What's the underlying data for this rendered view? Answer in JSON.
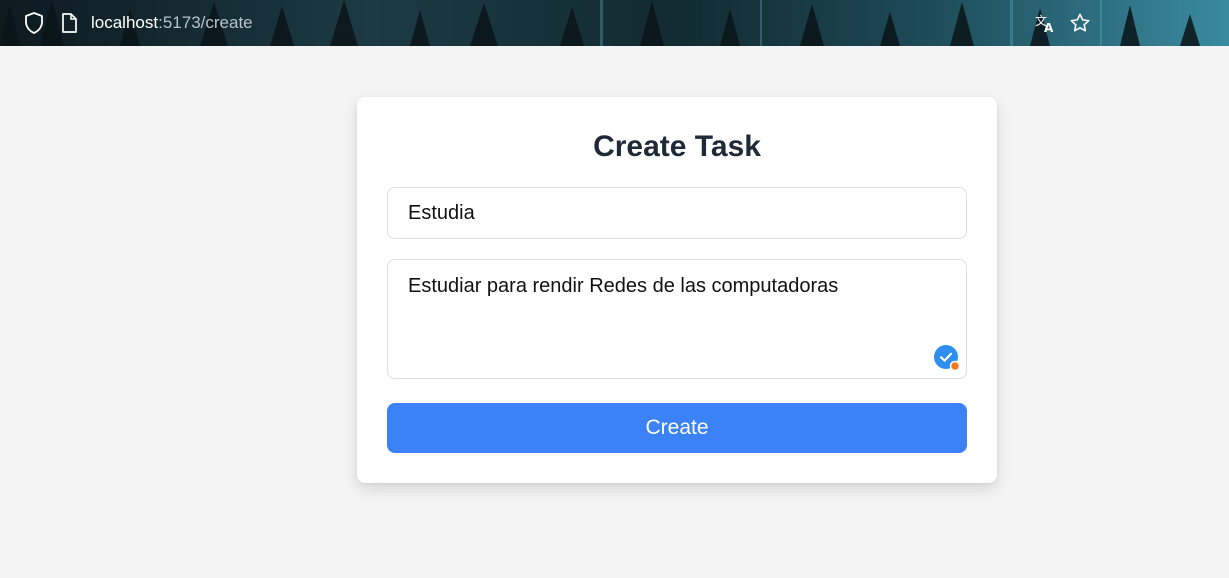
{
  "browser": {
    "url_host": "localhost",
    "url_path": ":5173/create",
    "icons": [
      "shield-icon",
      "page-icon",
      "translate-icon",
      "star-icon"
    ]
  },
  "form": {
    "title": "Create Task",
    "title_value": "Estudia",
    "description_value": "Estudiar para rendir Redes de las computadoras",
    "submit_label": "Create"
  },
  "colors": {
    "page_background": "#f4f4f4",
    "card_background": "#ffffff",
    "primary": "#3b82f6",
    "title_text": "#1f2937",
    "badge_blue": "#2f8ff0",
    "badge_dot": "#f07a24"
  }
}
